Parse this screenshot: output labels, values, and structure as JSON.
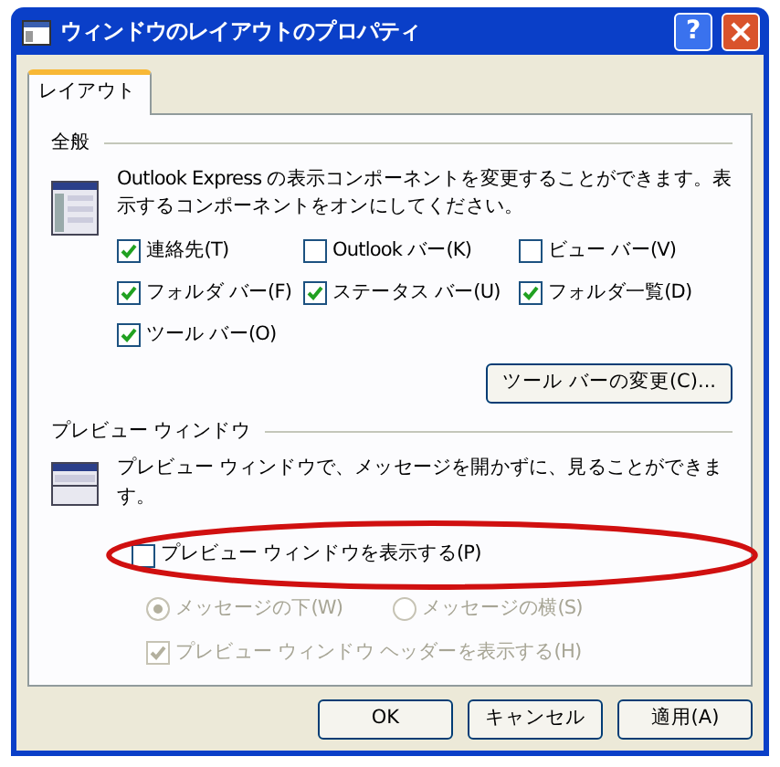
{
  "window": {
    "title": "ウィンドウのレイアウトのプロパティ",
    "help": "?"
  },
  "tabs": [
    {
      "label": "レイアウト",
      "selected": true
    }
  ],
  "general": {
    "heading": "全般",
    "description": "Outlook Express の表示コンポーネントを変更することができます。表示するコンポーネントをオンにしてください。",
    "options": [
      {
        "label": "連絡先(T)",
        "checked": true
      },
      {
        "label": "Outlook バー(K)",
        "checked": false
      },
      {
        "label": "ビュー バー(V)",
        "checked": false
      },
      {
        "label": "フォルダ バー(F)",
        "checked": true
      },
      {
        "label": "ステータス バー(U)",
        "checked": true
      },
      {
        "label": "フォルダ一覧(D)",
        "checked": true
      },
      {
        "label": "ツール バー(O)",
        "checked": true
      }
    ],
    "button": "ツール バーの変更(C)..."
  },
  "preview": {
    "heading": "プレビュー ウィンドウ",
    "description": "プレビュー ウィンドウで、メッセージを開かずに、見ることができます。",
    "show": {
      "label": "プレビュー ウィンドウを表示する(P)",
      "checked": false
    },
    "positions": [
      {
        "label": "メッセージの下(W)",
        "selected": true,
        "disabled": true
      },
      {
        "label": "メッセージの横(S)",
        "selected": false,
        "disabled": true
      }
    ],
    "header": {
      "label": "プレビュー ウィンドウ ヘッダーを表示する(H)",
      "checked": true,
      "disabled": true
    }
  },
  "buttons": [
    "OK",
    "キャンセル",
    "適用(A)"
  ]
}
